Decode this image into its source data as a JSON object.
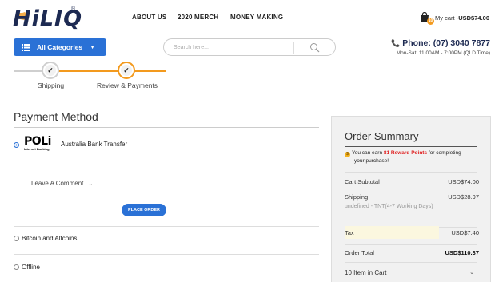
{
  "header": {
    "logo_text": "HiLIQ",
    "logo_reg": "®",
    "nav": [
      "ABOUT US",
      "2020 MERCH",
      "MONEY MAKING"
    ],
    "cart": {
      "badge": "10",
      "label": "My cart - ",
      "total": "USD$74.00"
    },
    "categories_label": "All Categories",
    "search_placeholder": "Search here...",
    "phone": "Phone: (07) 3040 7877",
    "hours": "Mon-Sat: 11:00AM - 7:00PM (QLD Time)"
  },
  "steps": [
    {
      "label": "Shipping",
      "state": "done"
    },
    {
      "label": "Review & Payments",
      "state": "active"
    }
  ],
  "payment": {
    "title": "Payment Method",
    "poli": {
      "logo_word": "POLi",
      "logo_sub": "Internet Banking",
      "name": "Australia Bank Transfer",
      "selected": true
    },
    "comment_label": "Leave A Comment",
    "place_order": "PLACE ORDER",
    "options": [
      {
        "label": "Bitcoin and Altcoins",
        "selected": false
      },
      {
        "label": "Offline",
        "selected": false
      }
    ]
  },
  "summary": {
    "title": "Order Summary",
    "reward_prefix": "You can earn ",
    "reward_points": "81 Reward Points",
    "reward_suffix": " for completing",
    "reward_line2": "your purchase!",
    "subtotal_label": "Cart Subtotal",
    "subtotal_value": "USD$74.00",
    "shipping_label": "Shipping",
    "shipping_value": "USD$28.97",
    "shipping_detail": "undefined - TNT(4-7 Working Days)",
    "tax_label": "Tax",
    "tax_value": "USD$7.40",
    "total_label": "Order Total",
    "total_value": "USD$110.37",
    "items_label": "10 Item in Cart"
  },
  "colors": {
    "accent_blue": "#2a71d6",
    "accent_orange": "#f39a1e",
    "reward_red": "#e02020"
  }
}
